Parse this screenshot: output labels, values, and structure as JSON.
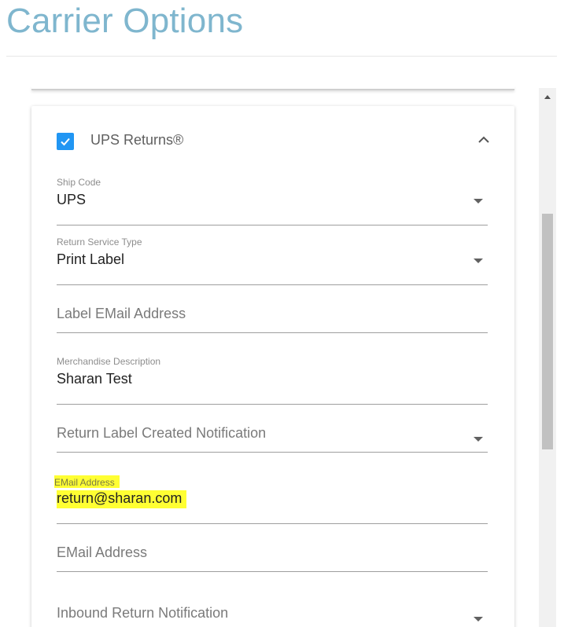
{
  "page": {
    "title": "Carrier Options"
  },
  "card": {
    "title": "UPS Returns®",
    "checked": true,
    "accent_color": "#2196f3",
    "highlight_color": "#ffff33"
  },
  "fields": {
    "ship_code": {
      "label": "Ship Code",
      "value": "UPS"
    },
    "return_service_type": {
      "label": "Return Service Type",
      "value": "Print Label"
    },
    "label_email": {
      "placeholder": "Label EMail Address"
    },
    "merchandise_description": {
      "label": "Merchandise Description",
      "value": "Sharan Test"
    },
    "return_label_created_notification": {
      "placeholder": "Return Label Created Notification"
    },
    "notification_email": {
      "label": "EMail Address",
      "value": "return@sharan.com"
    },
    "email_address_2": {
      "placeholder": "EMail Address"
    },
    "inbound_return_notification": {
      "placeholder": "Inbound Return Notification"
    }
  },
  "icons": {
    "checkbox": "check-icon",
    "collapse": "chevron-up-icon",
    "dropdown": "caret-down-icon",
    "scroll_up": "scroll-up-arrow-icon"
  }
}
